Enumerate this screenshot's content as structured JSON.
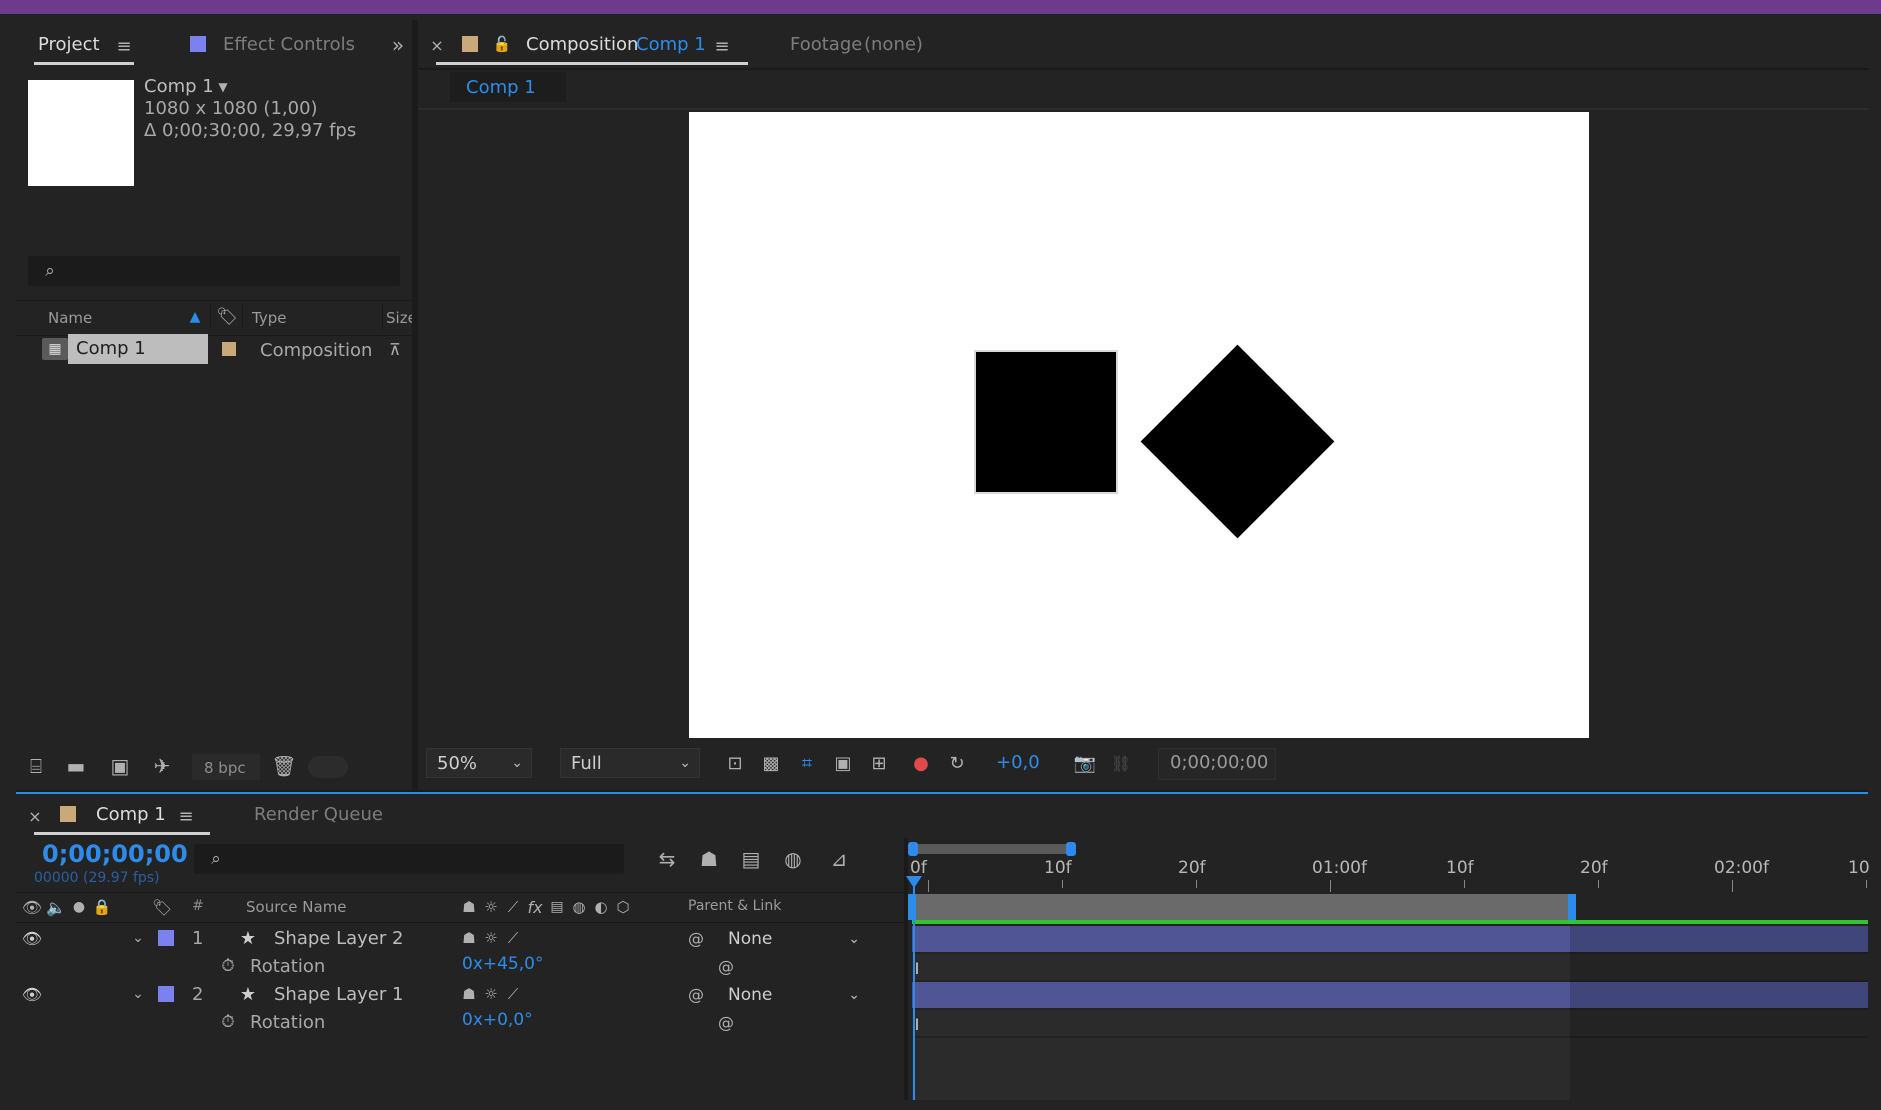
{
  "colors": {
    "accent_blue": "#2d8ceb",
    "layer_label": "#7b82f0",
    "comp_label": "#c9a97a",
    "bar": "#4f5595",
    "work_area": "#6a6a6a",
    "green_line": "#35c23b"
  },
  "project_panel": {
    "tab_project": "Project",
    "tab_effect_controls": "Effect Controls",
    "comp_name": "Comp 1",
    "comp_size": "1080 x 1080 (1,00)",
    "comp_duration": "Δ 0;00;30;00, 29,97 fps",
    "col_name": "Name",
    "col_type": "Type",
    "col_size": "Size",
    "item_name": "Comp 1",
    "item_type": "Composition",
    "bpc": "8 bpc"
  },
  "composition_panel": {
    "tab_prefix": "Composition",
    "tab_comp": "Comp 1",
    "footage_tab": "Footage",
    "footage_value": "(none)",
    "breadcrumb": "Comp 1",
    "zoom": "50%",
    "resolution": "Full",
    "exposure": "+0,0",
    "timecode": "0;00;00;00"
  },
  "timeline": {
    "tab_comp": "Comp 1",
    "tab_render_queue": "Render Queue",
    "timecode": "0;00;00;00",
    "frame_info": "00000 (29.97 fps)",
    "col_hash": "#",
    "col_source": "Source Name",
    "col_parent": "Parent & Link",
    "ruler": [
      "0f",
      "10f",
      "20f",
      "01:00f",
      "10f",
      "20f",
      "02:00f",
      "10"
    ],
    "layers": [
      {
        "num": "1",
        "name": "Shape Layer 2",
        "prop": "Rotation",
        "value": "0x+45,0°",
        "parent": "None"
      },
      {
        "num": "2",
        "name": "Shape Layer 1",
        "prop": "Rotation",
        "value": "0x+0,0°",
        "parent": "None"
      }
    ]
  }
}
